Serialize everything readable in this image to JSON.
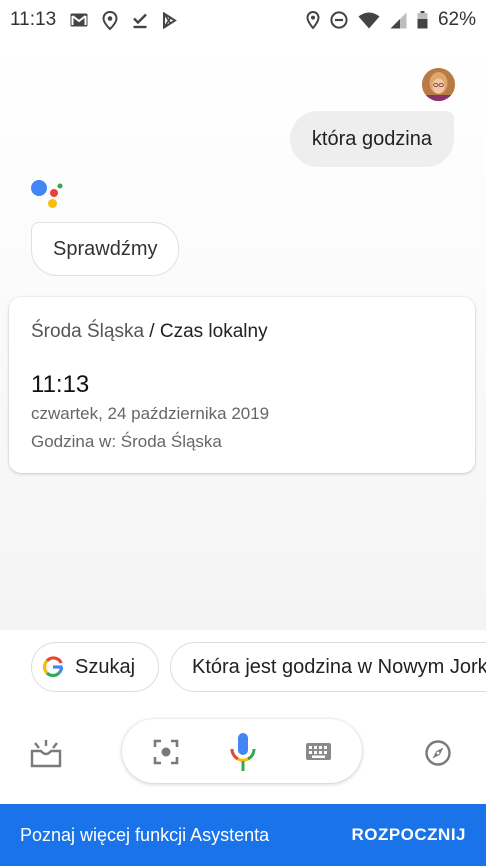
{
  "status_bar": {
    "time": "11:13",
    "battery": "62%",
    "left_icons": [
      "gmail-icon",
      "maps-location-icon",
      "download-done-icon",
      "play-store-icon"
    ],
    "right_icons": [
      "location-icon",
      "do-not-disturb-icon",
      "wifi-icon",
      "signal-icon",
      "battery-icon"
    ]
  },
  "conversation": {
    "user_query": "która godzina",
    "assistant_reply": "Sprawdźmy"
  },
  "time_card": {
    "location": "Środa Śląska",
    "separator": "/",
    "subject": "Czas lokalny",
    "time": "11:13",
    "date": "czwartek, 24 października 2019",
    "location_line": "Godzina w: Środa Śląska"
  },
  "suggestions": {
    "search_label": "Szukaj",
    "suggestion_label": "Która jest godzina w Nowym Jorku"
  },
  "banner": {
    "text": "Poznaj więcej funkcji Asystenta",
    "action": "ROZPOCZNIJ"
  },
  "colors": {
    "banner": "#1a73e8",
    "google_blue": "#4285f4",
    "google_red": "#ea4335",
    "google_yellow": "#fbbc05",
    "google_green": "#34a853"
  }
}
